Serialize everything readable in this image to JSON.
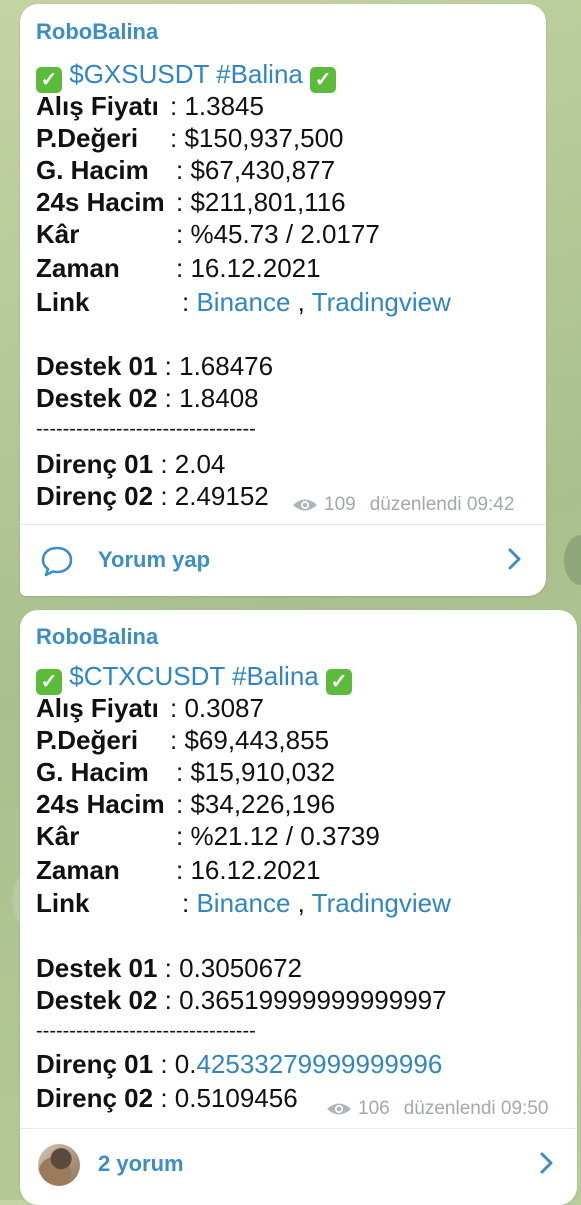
{
  "posts": [
    {
      "author": "RoboBalina",
      "title": "$GXSUSDT #Balina",
      "rows": [
        {
          "label": "Alış Fiyatı",
          "value": ": 1.3845"
        },
        {
          "label": "P.Değeri",
          "value": ": $150,937,500"
        },
        {
          "label": "G. Hacim",
          "value": ": $67,430,877"
        },
        {
          "label": "24s Hacim",
          "value": ": $211,801,116"
        },
        {
          "label": "Kâr",
          "value": ": %45.73 / 2.0177"
        },
        {
          "label": "Zaman",
          "value": ": 16.12.2021"
        }
      ],
      "link_label": "Link",
      "link_sep": ":",
      "link1": "Binance",
      "link_comma": ",",
      "link2": "Tradingview",
      "support1_label": "Destek 01",
      "support1_value": ": 1.68476",
      "support2_label": "Destek 02",
      "support2_value": ": 1.8408",
      "separator": "---------------------------------",
      "resist1_label": "Direnç 01",
      "resist1_value": ": 2.04",
      "resist2_label": "Direnç 02",
      "resist2_value": ": 2.49152",
      "views": "109",
      "edited": "düzenlendi 09:42",
      "footer": "Yorum yap"
    },
    {
      "author": "RoboBalina",
      "title": "$CTXCUSDT #Balina",
      "rows": [
        {
          "label": "Alış Fiyatı",
          "value": ": 0.3087"
        },
        {
          "label": "P.Değeri",
          "value": ": $69,443,855"
        },
        {
          "label": "G. Hacim",
          "value": ": $15,910,032"
        },
        {
          "label": "24s Hacim",
          "value": ": $34,226,196"
        },
        {
          "label": "Kâr",
          "value": ": %21.12 / 0.3739"
        },
        {
          "label": "Zaman",
          "value": ": 16.12.2021"
        }
      ],
      "link_label": "Link",
      "link_sep": ":",
      "link1": "Binance",
      "link_comma": ",",
      "link2": "Tradingview",
      "support1_label": "Destek 01",
      "support1_value": ": 0.3050672",
      "support2_label": "Destek 02",
      "support2_value": ": 0.36519999999999997",
      "separator": "---------------------------------",
      "resist1_label": "Direnç 01",
      "resist1_value_prefix": ": 0.",
      "resist1_value_link": "42533279999999996",
      "resist2_label": "Direnç 02",
      "resist2_value": ": 0.5109456",
      "views": "106",
      "edited": "düzenlendi 09:50",
      "footer": "2 yorum"
    }
  ],
  "colors": {
    "accent": "#3c8ec4",
    "link": "#2f86c2",
    "check": "#5dbb3c",
    "meta": "#a3a8ad"
  },
  "icons": [
    "check-icon",
    "eye-icon",
    "comment-bubble-icon",
    "chevron-right-icon",
    "avatar"
  ]
}
